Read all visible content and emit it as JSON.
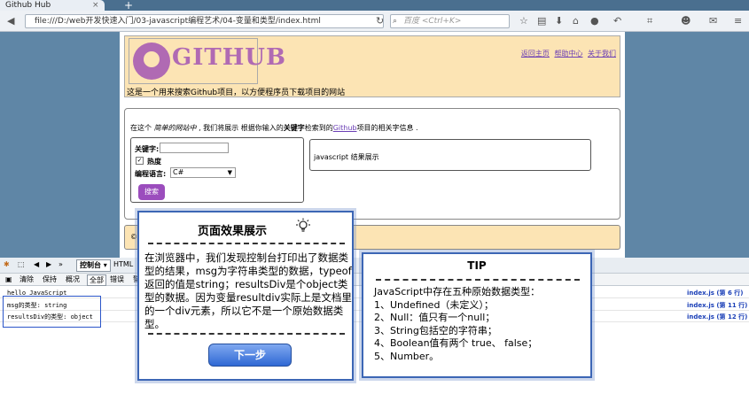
{
  "browser": {
    "tab_title": "Github Hub",
    "tab_close": "×",
    "new_tab": "+",
    "url": "file:///D:/web开发快速入门/03-javascript编程艺术/04-变量和类型/index.html",
    "search_placeholder": "百度 <Ctrl+K>"
  },
  "page": {
    "logo_text": "GITHUB",
    "tagline": "这是一个用来搜索Github项目，以方便程序员下载项目的网站",
    "top_links": [
      "返回主页",
      "帮助中心",
      "关于我们"
    ],
    "intro": {
      "part1": "在这个",
      "italic": "简单的网站中",
      "part2": ", 我们将展示 根据你输入的",
      "bold": "关键字",
      "part3": "检索到的",
      "link": "Github",
      "part4": "项目的相关字信息 ."
    },
    "form": {
      "keyword_label": "关键字:",
      "hot_label": "热度",
      "hot_checked": "✓",
      "lang_label": "编程语言:",
      "lang_value": "C#",
      "search_button": "搜索"
    },
    "result_text": "javascript 结果展示",
    "footer_text": "©"
  },
  "devtools": {
    "tab_console": "控制台",
    "tab_html": "HTML",
    "sub_clear": "清除",
    "sub_persist": "保持",
    "sub_profile": "概况",
    "sub_all": "全部",
    "sub_errors": "错误",
    "sub_warnings": "警",
    "logs": [
      {
        "msg": "hello JavaScript",
        "src": "index.js (第 6 行)"
      },
      {
        "msg": "msg的类型:  string",
        "src": "index.js (第 11 行)"
      },
      {
        "msg": "resultsDiv的类型: object",
        "src": "index.js (第 12 行)"
      }
    ]
  },
  "callout1": {
    "title": "页面效果展示",
    "body": "在浏览器中，我们发现控制台打印出了数据类型的结果，msg为字符串类型的数据，typeof返回的值是string；resultsDiv是个object类型的数据。因为变量resultdiv实际上是文档里的一个div元素，所以它不是一个原始数据类型。",
    "next_button": "下一步"
  },
  "callout2": {
    "title": "TIP",
    "lines": [
      "JavaScript中存在五种原始数据类型：",
      "1、Undefined（未定义）；",
      "2、Null：值只有一个null；",
      "3、String包括空的字符串；",
      "4、Boolean值有两个 true、 false；",
      "5、Number。"
    ]
  }
}
